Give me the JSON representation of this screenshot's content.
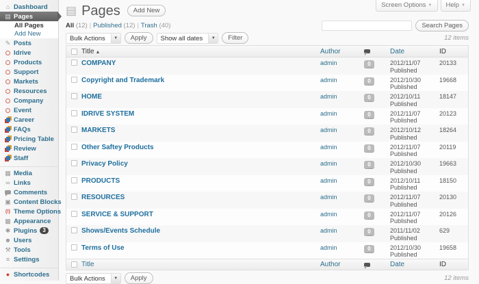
{
  "screen_tabs": {
    "screen_options": "Screen Options",
    "help": "Help"
  },
  "header": {
    "title": "Pages",
    "add_new": "Add New"
  },
  "views": [
    {
      "label": "All",
      "count": "(12)",
      "active": true
    },
    {
      "label": "Published",
      "count": "(12)",
      "active": false
    },
    {
      "label": "Trash",
      "count": "(40)",
      "active": false
    }
  ],
  "search": {
    "value": "",
    "button": "Search Pages"
  },
  "tablenav": {
    "bulk_actions": "Bulk Actions",
    "apply": "Apply",
    "dates_filter": "Show all dates",
    "filter": "Filter",
    "items_count": "12 items"
  },
  "table": {
    "headers": {
      "title": "Title",
      "author": "Author",
      "comments": "comment-bubble-icon",
      "date": "Date",
      "id": "ID"
    },
    "sort": {
      "column": "Title",
      "direction": "asc"
    },
    "rows": [
      {
        "title": "COMPANY",
        "author": "admin",
        "comments": "0",
        "date": "2012/11/07",
        "status": "Published",
        "id": "20133"
      },
      {
        "title": "Copyright and Trademark",
        "author": "admin",
        "comments": "0",
        "date": "2012/10/30",
        "status": "Published",
        "id": "19668"
      },
      {
        "title": "HOME",
        "author": "admin",
        "comments": "0",
        "date": "2012/10/11",
        "status": "Published",
        "id": "18147"
      },
      {
        "title": "IDRIVE SYSTEM",
        "author": "admin",
        "comments": "0",
        "date": "2012/11/07",
        "status": "Published",
        "id": "20123"
      },
      {
        "title": "MARKETS",
        "author": "admin",
        "comments": "0",
        "date": "2012/10/12",
        "status": "Published",
        "id": "18264"
      },
      {
        "title": "Other Saftey Products",
        "author": "admin",
        "comments": "0",
        "date": "2012/11/07",
        "status": "Published",
        "id": "20119"
      },
      {
        "title": "Privacy Policy",
        "author": "admin",
        "comments": "0",
        "date": "2012/10/30",
        "status": "Published",
        "id": "19663"
      },
      {
        "title": "PRODUCTS",
        "author": "admin",
        "comments": "0",
        "date": "2012/10/11",
        "status": "Published",
        "id": "18150"
      },
      {
        "title": "RESOURCES",
        "author": "admin",
        "comments": "0",
        "date": "2012/11/07",
        "status": "Published",
        "id": "20130"
      },
      {
        "title": "SERVICE & SUPPORT",
        "author": "admin",
        "comments": "0",
        "date": "2012/11/07",
        "status": "Published",
        "id": "20126"
      },
      {
        "title": "Shows/Events Schedule",
        "author": "admin",
        "comments": "0",
        "date": "2011/11/02",
        "status": "Published",
        "id": "629"
      },
      {
        "title": "Terms of Use",
        "author": "admin",
        "comments": "0",
        "date": "2012/10/30",
        "status": "Published",
        "id": "19658"
      }
    ]
  },
  "sidebar": {
    "items": [
      {
        "type": "item",
        "label": "Dashboard",
        "icon": "dashboard-icon"
      },
      {
        "type": "item",
        "label": "Pages",
        "icon": "pages-icon",
        "active": true
      },
      {
        "type": "submenu",
        "label": "All Pages",
        "current": true
      },
      {
        "type": "submenu",
        "label": "Add New"
      },
      {
        "type": "item",
        "label": "Posts",
        "icon": "posts-icon"
      },
      {
        "type": "item",
        "label": "Idrive",
        "icon": "ring-icon"
      },
      {
        "type": "item",
        "label": "Products",
        "icon": "ring-icon"
      },
      {
        "type": "item",
        "label": "Support",
        "icon": "ring-icon"
      },
      {
        "type": "item",
        "label": "Markets",
        "icon": "ring-icon"
      },
      {
        "type": "item",
        "label": "Resources",
        "icon": "ring-icon"
      },
      {
        "type": "item",
        "label": "Company",
        "icon": "ring-icon"
      },
      {
        "type": "item",
        "label": "Event",
        "icon": "ring-icon"
      },
      {
        "type": "item",
        "label": "Career",
        "icon": "layers-icon"
      },
      {
        "type": "item",
        "label": "FAQs",
        "icon": "layers-icon"
      },
      {
        "type": "item",
        "label": "Pricing Table",
        "icon": "layers-icon"
      },
      {
        "type": "item",
        "label": "Review",
        "icon": "layers-icon"
      },
      {
        "type": "item",
        "label": "Staff",
        "icon": "layers-icon"
      },
      {
        "type": "separator"
      },
      {
        "type": "item",
        "label": "Media",
        "icon": "media-icon"
      },
      {
        "type": "item",
        "label": "Links",
        "icon": "links-icon"
      },
      {
        "type": "item",
        "label": "Comments",
        "icon": "comments-icon"
      },
      {
        "type": "item",
        "label": "Content Blocks",
        "icon": "content-blocks-icon"
      },
      {
        "type": "item",
        "label": "Theme Options",
        "icon": "theme-options-icon"
      },
      {
        "type": "item",
        "label": "Appearance",
        "icon": "appearance-icon"
      },
      {
        "type": "item",
        "label": "Plugins",
        "icon": "plugins-icon",
        "badge": "3"
      },
      {
        "type": "item",
        "label": "Users",
        "icon": "users-icon"
      },
      {
        "type": "item",
        "label": "Tools",
        "icon": "tools-icon"
      },
      {
        "type": "item",
        "label": "Settings",
        "icon": "settings-icon"
      },
      {
        "type": "separator"
      },
      {
        "type": "item",
        "label": "Shortcodes",
        "icon": "shortcodes-icon"
      }
    ]
  },
  "colors": {
    "link_blue": "#21759B",
    "menu_active_bg": "#6d6d6d",
    "cpt_icon_red": "#cf6a5d",
    "accent_red": "#cf3d2e",
    "comment_badge_bg": "#bbbbbb",
    "header_gradient_bottom": "#ececec"
  }
}
